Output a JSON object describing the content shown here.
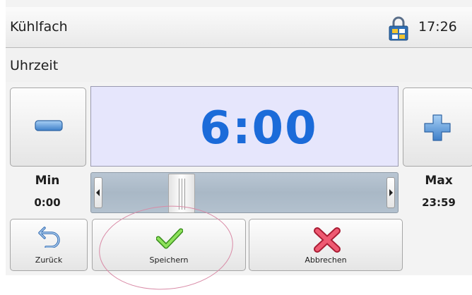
{
  "header": {
    "title": "Kühlfach",
    "time": "17:26",
    "lock_icon": "padlock-icon"
  },
  "section": {
    "label": "Uhrzeit"
  },
  "value": {
    "display": "6:00",
    "color": "#1b6bd9"
  },
  "controls": {
    "minus_icon": "minus-icon",
    "plus_icon": "plus-icon"
  },
  "limits": {
    "min_label": "Min",
    "min_value": "0:00",
    "max_label": "Max",
    "max_value": "23:59"
  },
  "slider": {
    "level": 0.25
  },
  "actions": {
    "back_label": "Zurück",
    "save_label": "Speichern",
    "cancel_label": "Abbrechen",
    "back_icon": "undo-arrow-icon",
    "save_icon": "checkmark-icon",
    "cancel_icon": "x-icon"
  },
  "colors": {
    "save_check": "#6ccf3a",
    "cancel_x": "#e0334f",
    "highlight": "#d98aa6"
  }
}
